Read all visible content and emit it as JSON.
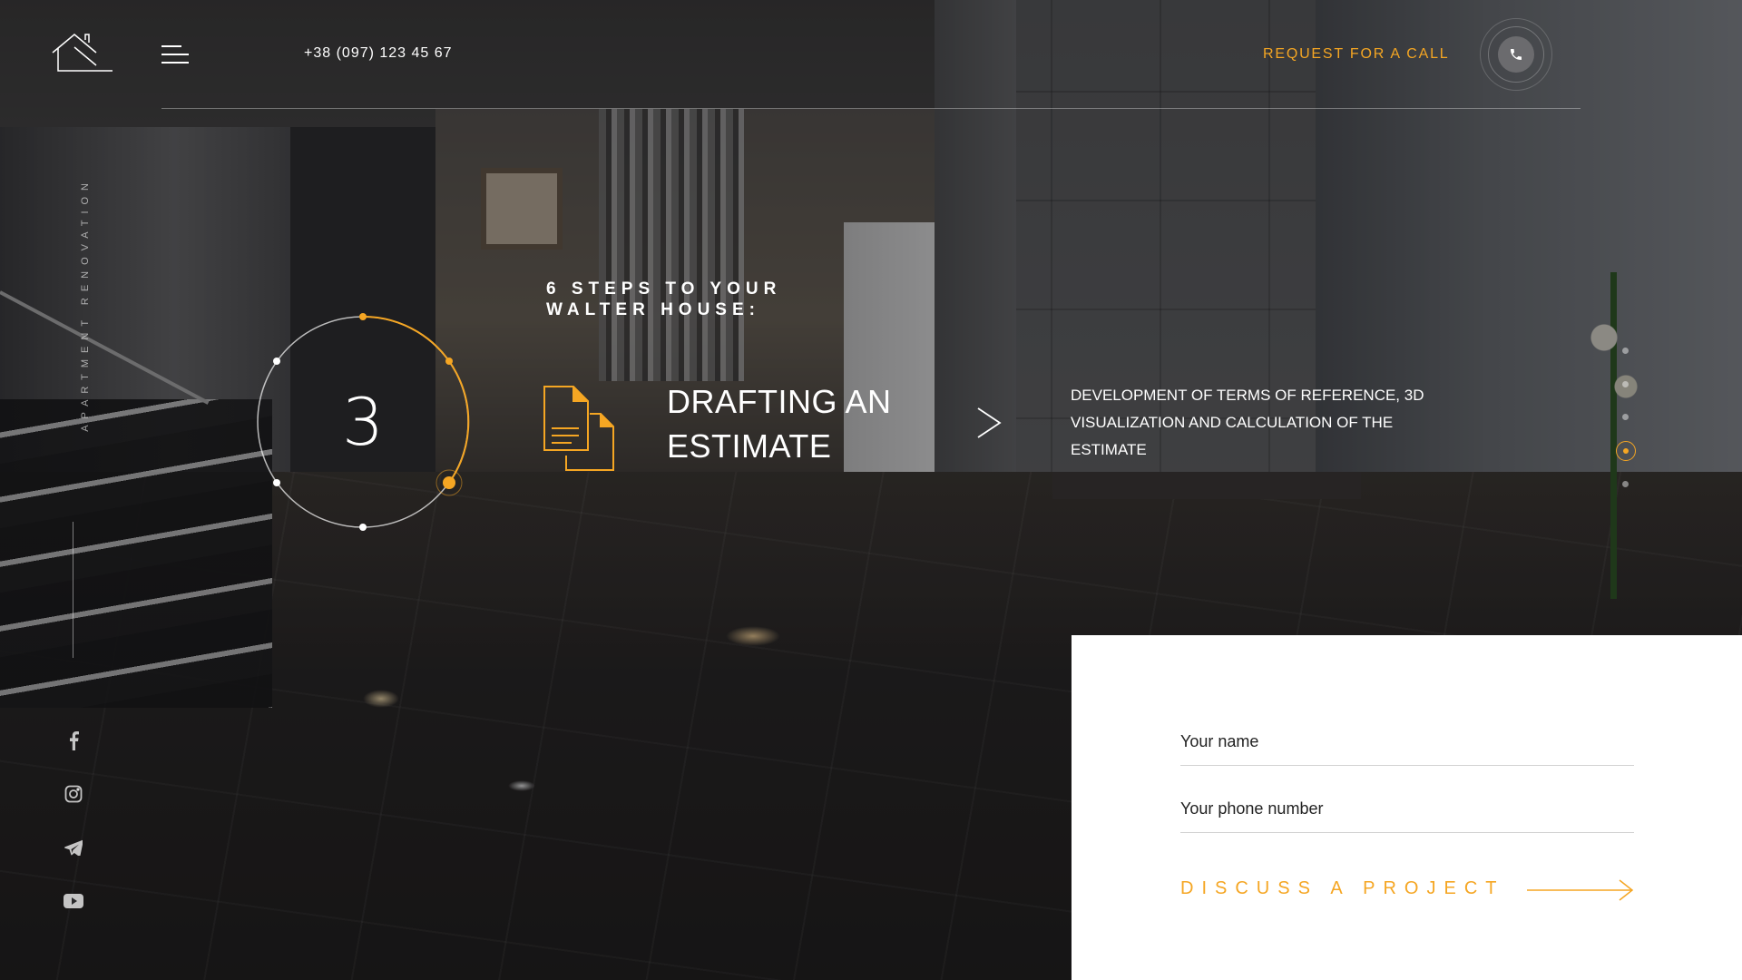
{
  "header": {
    "phone": "+38 (097) 123 45 67",
    "request_call_label": "REQUEST FOR A CALL"
  },
  "sidebar": {
    "vertical_label": "APARTMENT RENOVATION",
    "socials": [
      "facebook-icon",
      "instagram-icon",
      "telegram-icon",
      "youtube-icon"
    ]
  },
  "steps": {
    "title": "6 STEPS TO YOUR WALTER HOUSE:",
    "current_number": "3",
    "heading": "DRAFTING AN ESTIMATE",
    "description": "DEVELOPMENT OF TERMS OF REFERENCE, 3D VISUALIZATION AND CALCULATION OF THE ESTIMATE",
    "total_steps": 6,
    "active_dot_index": 3
  },
  "form": {
    "name_placeholder": "Your name",
    "phone_placeholder": "Your phone number",
    "submit_label": "DISCUSS A PROJECT"
  },
  "colors": {
    "accent": "#f5a623",
    "form_bg": "#ffffff",
    "text": "#ffffff"
  }
}
